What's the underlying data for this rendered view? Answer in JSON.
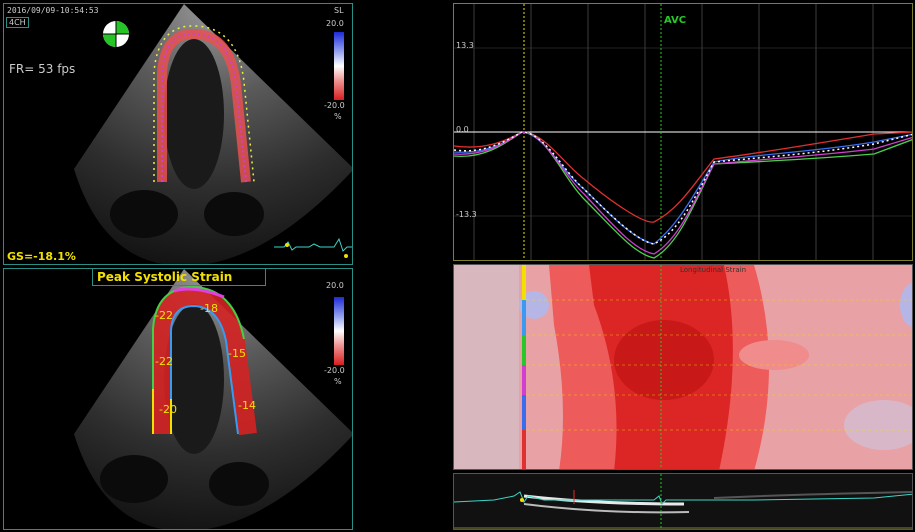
{
  "top_left": {
    "timestamp": "2016/09/09-10:54:53",
    "view": "4CH",
    "frame_rate": "FR=  53 fps",
    "scale_label": "SL",
    "scale_max": "20.0",
    "scale_min": "-20.0",
    "scale_unit": "%",
    "global_strain": "GS=-18.1%"
  },
  "bottom_left": {
    "title": "Peak Systolic Strain",
    "scale_max": "20.0",
    "scale_min": "-20.0",
    "scale_unit": "%",
    "segment_values": [
      "-22",
      "-22",
      "-20",
      "-18",
      "-15",
      "-14"
    ]
  },
  "strain_curves": {
    "event_label": "AVC",
    "y_ticks": [
      "13.3",
      "0.0",
      "-13.3"
    ]
  },
  "strain_map": {
    "title": "Longitudinal Strain"
  },
  "colors": {
    "panel_border": "#2a8f86",
    "label_yellow": "#f2e000",
    "avc_green": "#28c828"
  }
}
